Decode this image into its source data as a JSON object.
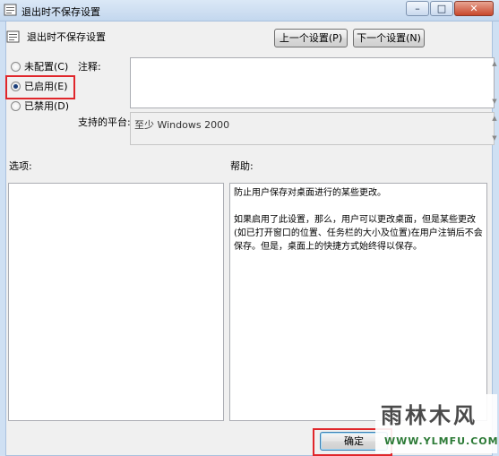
{
  "window": {
    "title": "退出时不保存设置",
    "minimize_glyph": "–",
    "maximize_glyph": "□",
    "close_glyph": "✕"
  },
  "header": {
    "setting_name": "退出时不保存设置",
    "prev_label": "上一个设置(P)",
    "next_label": "下一个设置(N)"
  },
  "state_options": [
    {
      "label": "未配置(C)",
      "checked": false
    },
    {
      "label": "已启用(E)",
      "checked": true
    },
    {
      "label": "已禁用(D)",
      "checked": false
    }
  ],
  "labels": {
    "comment": "注释:",
    "platform": "支持的平台:",
    "options": "选项:",
    "help": "帮助:"
  },
  "platform_value": "至少 Windows 2000",
  "help_paragraphs": [
    "防止用户保存对桌面进行的某些更改。",
    "如果启用了此设置，那么，用户可以更改桌面，但是某些更改(如已打开窗口的位置、任务栏的大小及位置)在用户注销后不会保存。但是，桌面上的快捷方式始终得以保存。"
  ],
  "footer": {
    "ok_label": "确定"
  },
  "watermark": {
    "text": "雨林木风",
    "url": "WWW.YLMFU.COM"
  },
  "colors": {
    "highlight": "#e0262b",
    "titlebar": "#c3d7ee"
  }
}
